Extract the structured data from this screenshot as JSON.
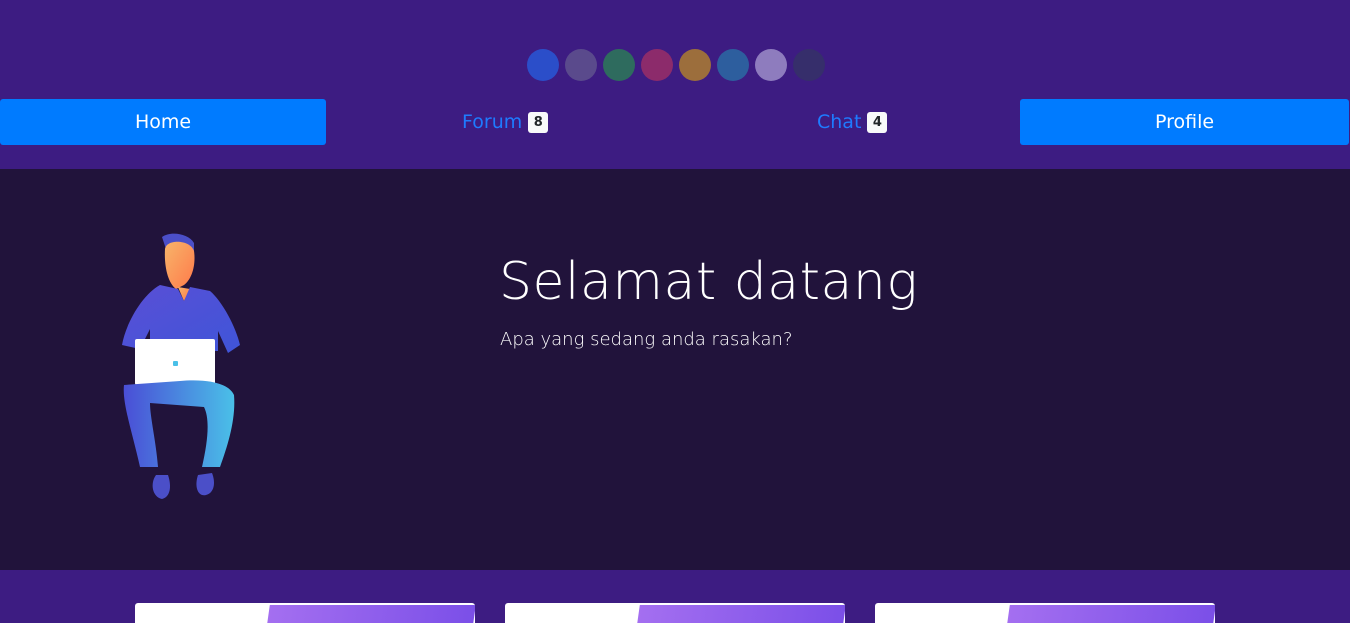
{
  "swatches": [
    {
      "name": "blue",
      "color": "#2b4ec9"
    },
    {
      "name": "slate-purple",
      "color": "#5a4a8c"
    },
    {
      "name": "teal-green",
      "color": "#2e6b5e"
    },
    {
      "name": "magenta",
      "color": "#8c2b6b"
    },
    {
      "name": "ochre",
      "color": "#9c6e3c"
    },
    {
      "name": "steel-blue",
      "color": "#2d5e9e"
    },
    {
      "name": "lavender",
      "color": "#8e7cbe"
    },
    {
      "name": "dark-navy",
      "color": "#362e6b"
    }
  ],
  "nav": {
    "home_label": "Home",
    "forum_label": "Forum",
    "forum_badge": "8",
    "chat_label": "Chat",
    "chat_badge": "4",
    "profile_label": "Profile"
  },
  "hero": {
    "title": "Selamat datang",
    "subtitle": "Apa yang sedang anda rasakan?"
  },
  "colors": {
    "header_bg": "#3d1c82",
    "hero_bg": "#21133b",
    "primary": "#007bff",
    "link": "#1e7bff"
  }
}
